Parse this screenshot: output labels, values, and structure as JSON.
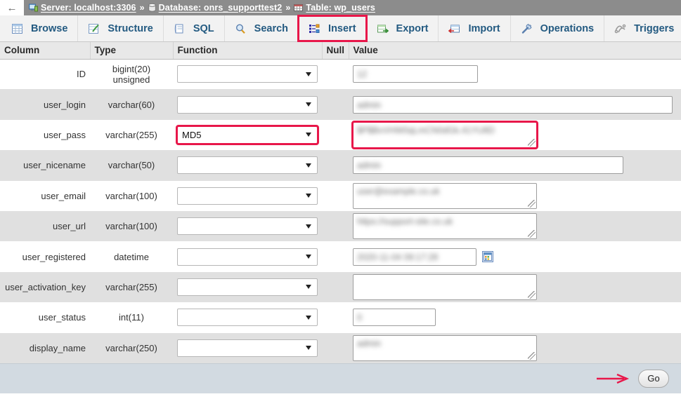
{
  "breadcrumb": {
    "back_label": "←",
    "server_icon": "server-icon",
    "server_label": "Server: localhost:3306",
    "sep1": "»",
    "database_icon": "database-icon",
    "database_label": "Database: onrs_supporttest2",
    "sep2": "»",
    "table_icon": "table-icon",
    "table_label": "Table: wp_users"
  },
  "tabs": [
    {
      "label": "Browse",
      "icon": "browse-icon",
      "active": false
    },
    {
      "label": "Structure",
      "icon": "structure-icon",
      "active": false
    },
    {
      "label": "SQL",
      "icon": "sql-icon",
      "active": false
    },
    {
      "label": "Search",
      "icon": "search-icon",
      "active": false
    },
    {
      "label": "Insert",
      "icon": "insert-icon",
      "active": true
    },
    {
      "label": "Export",
      "icon": "export-icon",
      "active": false
    },
    {
      "label": "Import",
      "icon": "import-icon",
      "active": false
    },
    {
      "label": "Operations",
      "icon": "operations-icon",
      "active": false
    },
    {
      "label": "Triggers",
      "icon": "triggers-icon",
      "active": false
    }
  ],
  "table": {
    "headers": {
      "column": "Column",
      "type": "Type",
      "function": "Function",
      "null": "Null",
      "value": "Value"
    },
    "rows": [
      {
        "column": "ID",
        "type": "bigint(20) unsigned",
        "function": "",
        "null": "",
        "value": "12",
        "value_kind": "input",
        "value_width": 178,
        "redacted": true,
        "highlight": false
      },
      {
        "column": "user_login",
        "type": "varchar(60)",
        "function": "",
        "null": "",
        "value": "admin",
        "value_kind": "input",
        "value_width": 455,
        "redacted": true,
        "highlight": false
      },
      {
        "column": "user_pass",
        "type": "varchar(255)",
        "function": "MD5",
        "null": "",
        "value": "$P$BvVHW0qLmCN0dGk.41YU8D",
        "value_kind": "area",
        "value_width": 262,
        "redacted": true,
        "highlight": true
      },
      {
        "column": "user_nicename",
        "type": "varchar(50)",
        "function": "",
        "null": "",
        "value": "admin",
        "value_kind": "input",
        "value_width": 385,
        "redacted": true,
        "highlight": false
      },
      {
        "column": "user_email",
        "type": "varchar(100)",
        "function": "",
        "null": "",
        "value": "user@example.co.uk",
        "value_kind": "area",
        "value_width": 262,
        "redacted": true,
        "highlight": false
      },
      {
        "column": "user_url",
        "type": "varchar(100)",
        "function": "",
        "null": "",
        "value": "https://support-site.co.uk",
        "value_kind": "area",
        "value_width": 262,
        "redacted": true,
        "highlight": false
      },
      {
        "column": "user_registered",
        "type": "datetime",
        "function": "",
        "null": "",
        "value": "2020-11-04 09:17:28",
        "value_kind": "date",
        "value_width": 176,
        "redacted": true,
        "highlight": false
      },
      {
        "column": "user_activation_key",
        "type": "varchar(255)",
        "function": "",
        "null": "",
        "value": "",
        "value_kind": "area",
        "value_width": 262,
        "redacted": false,
        "highlight": false
      },
      {
        "column": "user_status",
        "type": "int(11)",
        "function": "",
        "null": "",
        "value": "0",
        "value_kind": "input",
        "value_width": 118,
        "redacted": true,
        "highlight": false
      },
      {
        "column": "display_name",
        "type": "varchar(250)",
        "function": "",
        "null": "",
        "value": "admin",
        "value_kind": "area",
        "value_width": 262,
        "redacted": true,
        "highlight": false
      }
    ]
  },
  "footer": {
    "go_label": "Go",
    "arrow_icon": "arrow-right-icon"
  },
  "colors": {
    "highlight": "#e8174a",
    "breadcrumb_bg": "#8c8c8c",
    "tab_text": "#235a81",
    "row_alt": "#e0e0e0",
    "footer_bg": "#d2dae1"
  }
}
